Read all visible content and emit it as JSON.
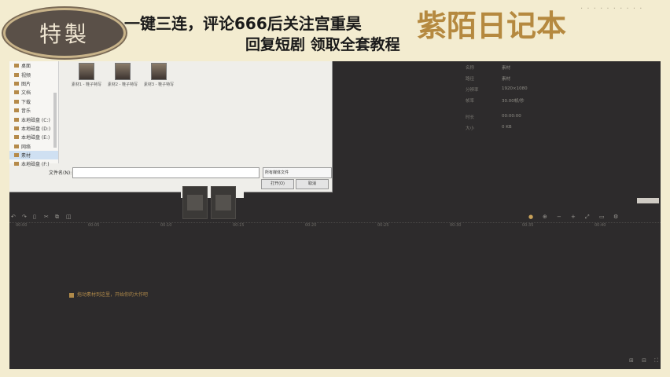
{
  "overlay": {
    "badge_text": "特製",
    "headline": "一键三连，评论666后关注宫重昊",
    "brand": "紫陌日记本",
    "subline": "回复短剧 领取全套教程",
    "deco_dots": "· · · · · · · · · ·"
  },
  "colors": {
    "frame": "#f3ecd0",
    "workspace": "#2d2b2c",
    "brand": "#b5893f",
    "accent_msg": "#b08a4a"
  },
  "dialog": {
    "sidebar_items": [
      {
        "label": "桌面",
        "selected": false
      },
      {
        "label": "视频",
        "selected": false
      },
      {
        "label": "图片",
        "selected": false
      },
      {
        "label": "文档",
        "selected": false
      },
      {
        "label": "下载",
        "selected": false
      },
      {
        "label": "音乐",
        "selected": false
      },
      {
        "label": "本地磁盘 (C:)",
        "selected": false
      },
      {
        "label": "本地磁盘 (D:)",
        "selected": false
      },
      {
        "label": "本地磁盘 (E:)",
        "selected": false
      },
      {
        "label": "网络",
        "selected": false
      },
      {
        "label": "素材",
        "selected": true
      },
      {
        "label": "本地磁盘 (F:)",
        "selected": false
      }
    ],
    "files": [
      {
        "name": "素材1 - 鞋子特写"
      },
      {
        "name": "素材2 - 鞋子特写"
      },
      {
        "name": "素材3 - 鞋子特写"
      }
    ],
    "filename_label": "文件名(N):",
    "filename_value": "",
    "file_type": "所有媒体文件",
    "open_button": "打开(O)",
    "cancel_button": "取消"
  },
  "properties": [
    {
      "key": "名称",
      "value": "素材"
    },
    {
      "key": "路径",
      "value": "素材"
    },
    {
      "key": "分辨率",
      "value": "1920×1080"
    },
    {
      "key": "帧率",
      "value": "30.00帧/秒"
    },
    {
      "key": "时长",
      "value": "00:00:00"
    },
    {
      "key": "大小",
      "value": "0 KB"
    }
  ],
  "timeline": {
    "tools": [
      "↶",
      "↷",
      "▯",
      "✂",
      "⧉",
      "◫"
    ],
    "right_tools": [
      "●",
      "⊕",
      "−",
      "+",
      "⤢",
      "▭",
      "⚙"
    ],
    "ticks": [
      "00:00",
      "00:05",
      "00:10",
      "00:15",
      "00:20",
      "00:25",
      "00:30",
      "00:35",
      "00:40"
    ],
    "empty_message": "拖动素材到这里，开始你的大作吧",
    "corner_icons": "⊞ ⊟ ⛶"
  }
}
